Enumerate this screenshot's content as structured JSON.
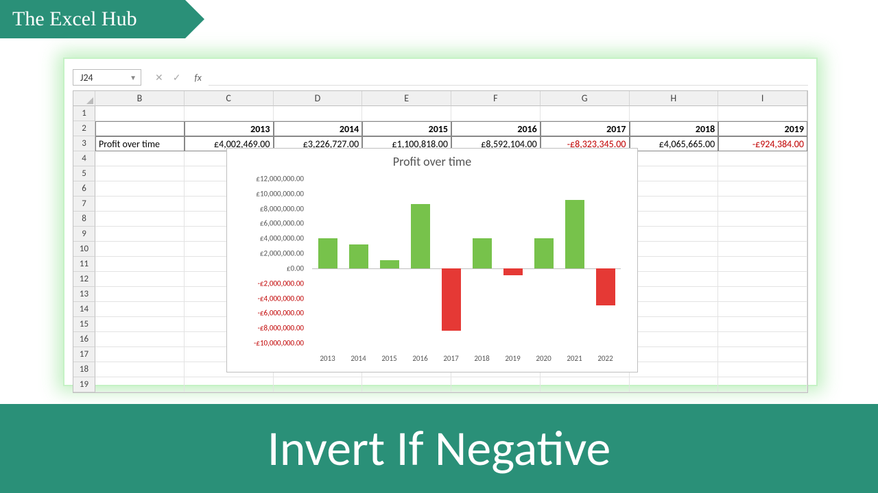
{
  "brand": "The Excel Hub",
  "footer_text": "Invert If Negative",
  "namebox": "J24",
  "fxbar_value": "",
  "columns": [
    "B",
    "C",
    "D",
    "E",
    "F",
    "G",
    "H",
    "I"
  ],
  "row_count": 19,
  "table": {
    "row_label": "Profit over time",
    "headers": [
      "2013",
      "2014",
      "2015",
      "2016",
      "2017",
      "2018",
      "2019"
    ],
    "values": [
      "£4,002,469.00",
      "£3,226,727.00",
      "£1,100,818.00",
      "£8,592,104.00",
      "-£8,323,345.00",
      "£4,065,665.00",
      "-£924,384.00"
    ],
    "value_neg": [
      false,
      false,
      false,
      false,
      true,
      false,
      true
    ]
  },
  "chart_data": {
    "type": "bar",
    "title": "Profit over time",
    "xlabel": "",
    "ylabel": "",
    "categories": [
      "2013",
      "2014",
      "2015",
      "2016",
      "2017",
      "2018",
      "2019",
      "2020",
      "2021",
      "2022"
    ],
    "values": [
      4002469,
      3226727,
      1100818,
      8592104,
      -8323345,
      4065665,
      -924384,
      4000000,
      9200000,
      -5000000
    ],
    "ylim": [
      -10000000,
      12000000
    ],
    "yticks": [
      12000000,
      10000000,
      8000000,
      6000000,
      4000000,
      2000000,
      0,
      -2000000,
      -4000000,
      -6000000,
      -8000000,
      -10000000
    ],
    "ytick_labels": [
      "£12,000,000.00",
      "£10,000,000.00",
      "£8,000,000.00",
      "£6,000,000.00",
      "£4,000,000.00",
      "£2,000,000.00",
      "£0.00",
      "-£2,000,000.00",
      "-£4,000,000.00",
      "-£6,000,000.00",
      "-£8,000,000.00",
      "-£10,000,000.00"
    ],
    "colors": {
      "positive": "#77c24b",
      "negative": "#e53935"
    }
  }
}
